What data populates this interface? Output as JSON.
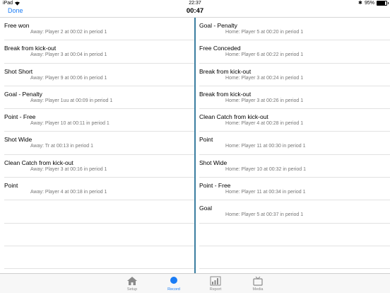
{
  "status": {
    "device": "iPad",
    "clock": "22:37",
    "battery": "95%"
  },
  "nav": {
    "done_label": "Done",
    "timer": "00:47"
  },
  "left_events": [
    {
      "title": "Free won",
      "detail": "Away: Player 2 at 00:02 in period 1"
    },
    {
      "title": "Break from kick-out",
      "detail": "Away: Player 3 at 00:04 in period 1"
    },
    {
      "title": "Shot Short",
      "detail": "Away: Player 9 at 00:06 in period 1"
    },
    {
      "title": "Goal - Penalty",
      "detail": "Away: Player 1uu at 00:09 in period 1"
    },
    {
      "title": "Point - Free",
      "detail": "Away: Player 10 at 00:11 in period 1"
    },
    {
      "title": "Shot Wide",
      "detail": "Away: Tr at 00:13 in period 1"
    },
    {
      "title": "Clean Catch from kick-out",
      "detail": "Away: Player 3 at 00:16 in period 1"
    },
    {
      "title": "Point",
      "detail": "Away: Player 4 at 00:18 in period 1"
    }
  ],
  "right_events": [
    {
      "title": "Goal - Penalty",
      "detail": "Home: Player 5 at 00:20 in period 1"
    },
    {
      "title": "Free Conceded",
      "detail": "Home: Player 6 at 00:22 in period 1"
    },
    {
      "title": "Break from kick-out",
      "detail": "Home: Player 3 at 00:24 in period 1"
    },
    {
      "title": "Break from kick-out",
      "detail": "Home: Player 3 at 00:26 in period 1"
    },
    {
      "title": "Clean Catch from kick-out",
      "detail": "Home: Player 4 at 00:28 in period 1"
    },
    {
      "title": "Point",
      "detail": "Home: Player 11 at 00:30 in period 1"
    },
    {
      "title": "Shot Wide",
      "detail": "Home: Player 10 at 00:32 in period 1"
    },
    {
      "title": "Point - Free",
      "detail": "Home: Player 11 at 00:34 in period 1"
    },
    {
      "title": "Goal",
      "detail": "Home: Player 5 at 00:37 in period 1"
    }
  ],
  "tabs": [
    {
      "label": "Setup",
      "icon": "house-icon",
      "active": false
    },
    {
      "label": "Record",
      "icon": "record-dot-icon",
      "active": true
    },
    {
      "label": "Report",
      "icon": "bar-chart-icon",
      "active": false
    },
    {
      "label": "Media",
      "icon": "tv-icon",
      "active": false
    }
  ],
  "colors": {
    "accent": "#1a7cf5",
    "divider": "#3b7ea1"
  }
}
